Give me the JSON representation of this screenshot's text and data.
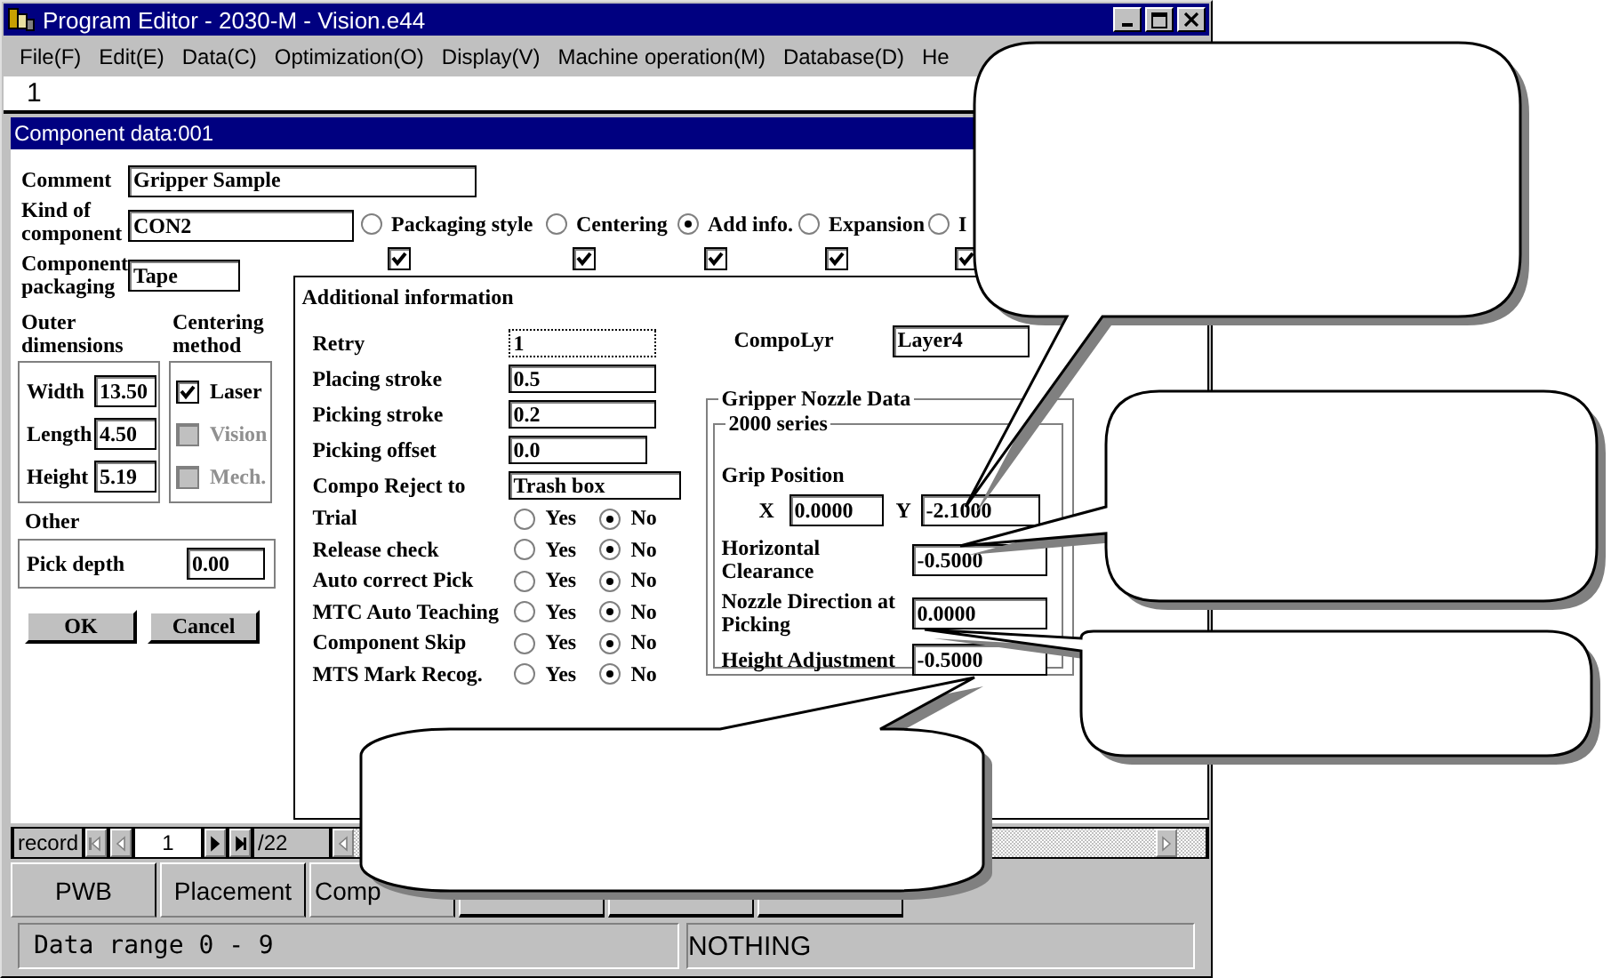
{
  "window": {
    "title": "Program Editor - 2030-M - Vision.e44"
  },
  "menu": [
    "File(F)",
    "Edit(E)",
    "Data(C)",
    "Optimization(O)",
    "Display(V)",
    "Machine operation(M)",
    "Database(D)",
    "He"
  ],
  "toolbar_field": {
    "value": "1"
  },
  "dialog": {
    "title": "Component data:001",
    "comment": {
      "label": "Comment",
      "value": "Gripper Sample"
    },
    "kind_of_component": {
      "label": "Kind of component",
      "value": "CON2"
    },
    "page_options": [
      {
        "label": "Packaging style",
        "selected": false,
        "checked": true
      },
      {
        "label": "Centering",
        "selected": false,
        "checked": true
      },
      {
        "label": "Add info.",
        "selected": true,
        "checked": true
      },
      {
        "label": "Expansion",
        "selected": false,
        "checked": true
      },
      {
        "label": "I",
        "selected": false,
        "checked": true
      }
    ],
    "component_packaging": {
      "label": "Component packaging",
      "value": "Tape"
    },
    "outer_dimensions": {
      "title": "Outer dimensions",
      "fields": [
        {
          "label": "Width",
          "value": "13.50"
        },
        {
          "label": "Length",
          "value": "4.50"
        },
        {
          "label": "Height",
          "value": "5.19"
        }
      ]
    },
    "centering_method": {
      "title": "Centering method",
      "options": [
        {
          "label": "Laser",
          "checked": true,
          "disabled": false
        },
        {
          "label": "Vision",
          "checked": false,
          "disabled": true
        },
        {
          "label": "Mech.",
          "checked": false,
          "disabled": true
        }
      ]
    },
    "other": {
      "title": "Other",
      "fields": [
        {
          "label": "Pick depth",
          "value": "0.00"
        }
      ]
    },
    "buttons": [
      "OK",
      "Cancel"
    ],
    "additional_information": {
      "title": "Additional information",
      "rows": [
        {
          "kind": "field",
          "label": "Retry",
          "value": "1",
          "focused": true
        },
        {
          "kind": "field",
          "label": "Placing stroke",
          "value": "0.5",
          "focused": false
        },
        {
          "kind": "field",
          "label": "Picking stroke",
          "value": "0.2",
          "focused": false
        },
        {
          "kind": "field",
          "label": "Picking offset",
          "value": "0.0",
          "focused": false
        },
        {
          "kind": "field",
          "label": "Compo Reject to",
          "value": "Trash box",
          "focused": false
        },
        {
          "kind": "yes_no",
          "label": "Trial",
          "options": [
            {
              "label": "Yes",
              "selected": false
            },
            {
              "label": "No",
              "selected": true
            }
          ]
        },
        {
          "kind": "yes_no",
          "label": "Release check",
          "options": [
            {
              "label": "Yes",
              "selected": false
            },
            {
              "label": "No",
              "selected": true
            }
          ]
        },
        {
          "kind": "yes_no",
          "label": "Auto correct Pick",
          "options": [
            {
              "label": "Yes",
              "selected": false
            },
            {
              "label": "No",
              "selected": true
            }
          ]
        },
        {
          "kind": "yes_no",
          "label": "MTC Auto Teaching",
          "options": [
            {
              "label": "Yes",
              "selected": false
            },
            {
              "label": "No",
              "selected": true
            }
          ]
        },
        {
          "kind": "yes_no",
          "label": "Component Skip",
          "options": [
            {
              "label": "Yes",
              "selected": false
            },
            {
              "label": "No",
              "selected": true
            }
          ]
        },
        {
          "kind": "yes_no",
          "label": "MTS Mark Recog.",
          "options": [
            {
              "label": "Yes",
              "selected": false
            },
            {
              "label": "No",
              "selected": true
            }
          ]
        }
      ],
      "compo_lyr": {
        "label": "CompoLyr",
        "value": "Layer4"
      },
      "gripper_nozzle_data": {
        "title": "Gripper Nozzle Data",
        "series": {
          "title": "2000 series",
          "grip_position": {
            "label": "Grip Position",
            "x": {
              "label": "X",
              "value": "0.0000"
            },
            "y": {
              "label": "Y",
              "value": "-2.1000"
            }
          },
          "fields": [
            {
              "label": "Horizontal Clearance",
              "value": "-0.5000"
            },
            {
              "label": "Nozzle Direction at Picking",
              "value": "0.0000"
            },
            {
              "label": "Height Adjustment",
              "value": "-0.5000"
            }
          ]
        }
      }
    }
  },
  "record_nav": {
    "label": "record",
    "value": "1",
    "total": "/22"
  },
  "tabs": [
    {
      "kind": "labeled",
      "label": "PWB"
    },
    {
      "kind": "labeled",
      "label": "Placement"
    },
    {
      "kind": "labeled",
      "label": "Comp"
    },
    {
      "kind": "blank"
    },
    {
      "kind": "blank"
    },
    {
      "kind": "blank"
    }
  ],
  "status_bar": [
    "Data range 0 - 9",
    "NOTHING"
  ]
}
